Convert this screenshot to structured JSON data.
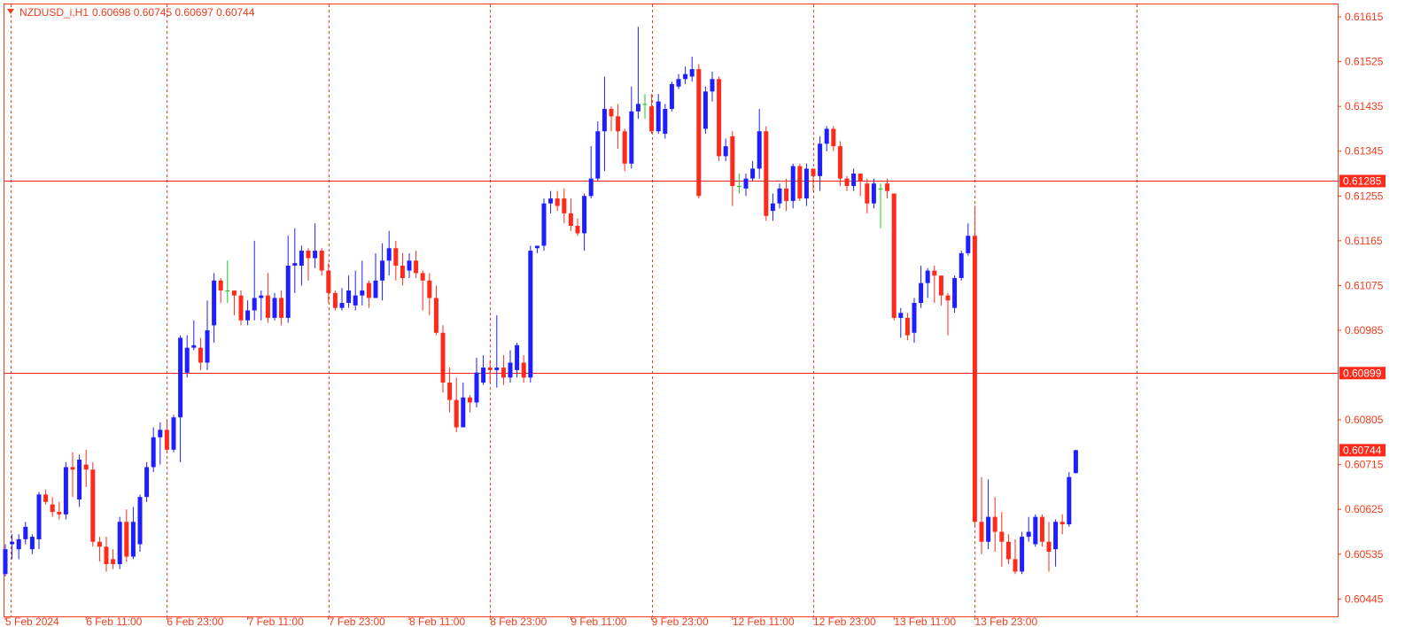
{
  "window": {
    "symbol": "NZDUSD_i,H1",
    "ohlc": "0.60698 0.60745 0.60697 0.60744"
  },
  "colors": {
    "frame": "#f23b1b",
    "bull": "#1e1eff",
    "bear": "#ff2a1a",
    "doji": "#22c322",
    "grid": "#f23b1b",
    "level_line": "#ff1a1a",
    "tag_bg": "#ff2a1a"
  },
  "chart_data": {
    "type": "candlestick",
    "title": "NZDUSD_i,H1",
    "ylim": [
      0.6041,
      0.6164
    ],
    "y_ticks": [
      "0.61615",
      "0.61525",
      "0.61435",
      "0.61345",
      "0.61255",
      "0.61165",
      "0.61075",
      "0.60985",
      "0.60805",
      "0.60715",
      "0.60625",
      "0.60535",
      "0.60445"
    ],
    "x_ticks": [
      "5 Feb 2024",
      "6 Feb 11:00",
      "6 Feb 23:00",
      "7 Feb 11:00",
      "7 Feb 23:00",
      "8 Feb 11:00",
      "8 Feb 23:00",
      "9 Feb 11:00",
      "9 Feb 23:00",
      "12 Feb 11:00",
      "12 Feb 23:00",
      "13 Feb 11:00",
      "13 Feb 23:00"
    ],
    "day_separators": [
      "6 Feb 2024",
      "7 Feb 2024",
      "8 Feb 2024",
      "9 Feb 2024",
      "12 Feb 2024",
      "13 Feb 2024",
      "14 Feb 2024"
    ],
    "horizontal_levels": [
      "0.61285",
      "0.60899"
    ],
    "current_price": "0.60744",
    "grid": false,
    "candles": [
      [
        0.60495,
        0.60545,
        0.6049,
        0.60555
      ],
      [
        0.60555,
        0.6056,
        0.60525,
        0.60575
      ],
      [
        0.60545,
        0.60565,
        0.60525,
        0.60575
      ],
      [
        0.60565,
        0.6059,
        0.60555,
        0.606
      ],
      [
        0.60545,
        0.6057,
        0.60535,
        0.60575
      ],
      [
        0.60565,
        0.60655,
        0.60545,
        0.6066
      ],
      [
        0.60655,
        0.6064,
        0.60635,
        0.60665
      ],
      [
        0.60635,
        0.6062,
        0.6061,
        0.6065
      ],
      [
        0.6062,
        0.60615,
        0.60605,
        0.6064
      ],
      [
        0.60615,
        0.6071,
        0.60605,
        0.6072
      ],
      [
        0.6071,
        0.60705,
        0.6065,
        0.6074
      ],
      [
        0.60645,
        0.60725,
        0.6063,
        0.60735
      ],
      [
        0.60715,
        0.60705,
        0.6067,
        0.60745
      ],
      [
        0.60705,
        0.6056,
        0.6055,
        0.6072
      ],
      [
        0.6056,
        0.6055,
        0.6052,
        0.6057
      ],
      [
        0.6055,
        0.60515,
        0.605,
        0.6057
      ],
      [
        0.60525,
        0.60515,
        0.60505,
        0.60545
      ],
      [
        0.60515,
        0.606,
        0.60505,
        0.6061
      ],
      [
        0.606,
        0.6053,
        0.6052,
        0.60625
      ],
      [
        0.6053,
        0.606,
        0.60525,
        0.6063
      ],
      [
        0.60555,
        0.6065,
        0.6054,
        0.60655
      ],
      [
        0.6065,
        0.6071,
        0.6064,
        0.6072
      ],
      [
        0.6071,
        0.6077,
        0.607,
        0.6079
      ],
      [
        0.6077,
        0.60785,
        0.60715,
        0.608
      ],
      [
        0.60785,
        0.60745,
        0.6074,
        0.60805
      ],
      [
        0.60745,
        0.6081,
        0.6074,
        0.60815
      ],
      [
        0.6081,
        0.6097,
        0.6072,
        0.60975
      ],
      [
        0.609,
        0.6095,
        0.6089,
        0.60975
      ],
      [
        0.6095,
        0.60955,
        0.60945,
        0.61005
      ],
      [
        0.6095,
        0.6092,
        0.60905,
        0.6097
      ],
      [
        0.6092,
        0.60985,
        0.60905,
        0.61045
      ],
      [
        0.60995,
        0.61085,
        0.6096,
        0.611
      ],
      [
        0.61085,
        0.61065,
        0.6104,
        0.6109
      ],
      [
        0.61065,
        0.61065,
        0.6104,
        0.61125
      ],
      [
        0.61065,
        0.61055,
        0.61015,
        0.6106
      ],
      [
        0.61055,
        0.61005,
        0.60995,
        0.61065
      ],
      [
        0.61005,
        0.61025,
        0.60995,
        0.61045
      ],
      [
        0.61025,
        0.6105,
        0.61005,
        0.61165
      ],
      [
        0.6105,
        0.61055,
        0.61005,
        0.61065
      ],
      [
        0.61055,
        0.6101,
        0.61,
        0.611
      ],
      [
        0.6101,
        0.6105,
        0.61005,
        0.6106
      ],
      [
        0.6105,
        0.6101,
        0.60995,
        0.61065
      ],
      [
        0.6101,
        0.61115,
        0.61,
        0.61175
      ],
      [
        0.61115,
        0.6112,
        0.6106,
        0.6119
      ],
      [
        0.61115,
        0.61145,
        0.61075,
        0.61155
      ],
      [
        0.61145,
        0.6113,
        0.61085,
        0.6115
      ],
      [
        0.6113,
        0.61145,
        0.6111,
        0.612
      ],
      [
        0.61145,
        0.61105,
        0.61095,
        0.6115
      ],
      [
        0.61105,
        0.6106,
        0.6104,
        0.6112
      ],
      [
        0.6106,
        0.6103,
        0.61025,
        0.61065
      ],
      [
        0.6103,
        0.6104,
        0.61025,
        0.6107
      ],
      [
        0.6104,
        0.61065,
        0.6103,
        0.61095
      ],
      [
        0.61035,
        0.61055,
        0.61025,
        0.61105
      ],
      [
        0.61055,
        0.61065,
        0.61035,
        0.61125
      ],
      [
        0.6108,
        0.6105,
        0.6103,
        0.61085
      ],
      [
        0.6105,
        0.61085,
        0.6105,
        0.6114
      ],
      [
        0.61085,
        0.61125,
        0.61045,
        0.6116
      ],
      [
        0.61125,
        0.6115,
        0.61095,
        0.61185
      ],
      [
        0.6115,
        0.61115,
        0.61085,
        0.61165
      ],
      [
        0.61115,
        0.6109,
        0.61075,
        0.6114
      ],
      [
        0.61105,
        0.61125,
        0.6109,
        0.6114
      ],
      [
        0.61125,
        0.611,
        0.6109,
        0.61145
      ],
      [
        0.611,
        0.61085,
        0.61025,
        0.61105
      ],
      [
        0.61085,
        0.6105,
        0.61015,
        0.611
      ],
      [
        0.6105,
        0.6098,
        0.60975,
        0.61075
      ],
      [
        0.6098,
        0.6088,
        0.6086,
        0.60995
      ],
      [
        0.6088,
        0.60845,
        0.6082,
        0.6091
      ],
      [
        0.60845,
        0.6079,
        0.6078,
        0.6089
      ],
      [
        0.6079,
        0.6085,
        0.6079,
        0.6088
      ],
      [
        0.6085,
        0.6084,
        0.6082,
        0.60855
      ],
      [
        0.6084,
        0.609,
        0.6083,
        0.6093
      ],
      [
        0.6088,
        0.6091,
        0.60875,
        0.60935
      ],
      [
        0.6091,
        0.60905,
        0.6088,
        0.60925
      ],
      [
        0.60905,
        0.6091,
        0.6087,
        0.61015
      ],
      [
        0.6091,
        0.6089,
        0.60875,
        0.60935
      ],
      [
        0.6089,
        0.6092,
        0.6088,
        0.60945
      ],
      [
        0.60905,
        0.60955,
        0.6089,
        0.6096
      ],
      [
        0.6092,
        0.6089,
        0.6088,
        0.60935
      ],
      [
        0.6089,
        0.61145,
        0.6088,
        0.61155
      ],
      [
        0.6115,
        0.61155,
        0.6114,
        0.6115
      ],
      [
        0.61155,
        0.6124,
        0.61145,
        0.6125
      ],
      [
        0.6124,
        0.6125,
        0.6122,
        0.61265
      ],
      [
        0.6125,
        0.61235,
        0.61225,
        0.61265
      ],
      [
        0.6125,
        0.6122,
        0.612,
        0.6127
      ],
      [
        0.6122,
        0.61195,
        0.61185,
        0.6125
      ],
      [
        0.61195,
        0.6118,
        0.61175,
        0.6121
      ],
      [
        0.6118,
        0.61255,
        0.61145,
        0.6126
      ],
      [
        0.61255,
        0.6129,
        0.6125,
        0.61355
      ],
      [
        0.6129,
        0.61385,
        0.61285,
        0.61405
      ],
      [
        0.61385,
        0.6143,
        0.61305,
        0.61495
      ],
      [
        0.6143,
        0.61415,
        0.61385,
        0.61435
      ],
      [
        0.61415,
        0.61385,
        0.6135,
        0.6144
      ],
      [
        0.61385,
        0.6132,
        0.61305,
        0.6139
      ],
      [
        0.6132,
        0.61425,
        0.6131,
        0.61475
      ],
      [
        0.61425,
        0.6144,
        0.6141,
        0.61595
      ],
      [
        0.6144,
        0.6144,
        0.6141,
        0.6146
      ],
      [
        0.61435,
        0.61385,
        0.6138,
        0.6146
      ],
      [
        0.61385,
        0.61445,
        0.6138,
        0.6146
      ],
      [
        0.6138,
        0.6143,
        0.6137,
        0.6144
      ],
      [
        0.6143,
        0.6148,
        0.61425,
        0.61485
      ],
      [
        0.61475,
        0.6149,
        0.6147,
        0.615
      ],
      [
        0.6149,
        0.615,
        0.6148,
        0.61515
      ],
      [
        0.61495,
        0.6151,
        0.61485,
        0.61535
      ],
      [
        0.6151,
        0.61255,
        0.6125,
        0.6152
      ],
      [
        0.6139,
        0.61465,
        0.6138,
        0.61475
      ],
      [
        0.61465,
        0.6149,
        0.61445,
        0.61505
      ],
      [
        0.6149,
        0.61335,
        0.61325,
        0.61495
      ],
      [
        0.61335,
        0.61355,
        0.61325,
        0.6137
      ],
      [
        0.61375,
        0.61275,
        0.61235,
        0.61385
      ],
      [
        0.61275,
        0.61275,
        0.6126,
        0.613
      ],
      [
        0.6127,
        0.6129,
        0.61255,
        0.613
      ],
      [
        0.6129,
        0.6131,
        0.61285,
        0.61325
      ],
      [
        0.6131,
        0.61385,
        0.6129,
        0.6143
      ],
      [
        0.61385,
        0.61215,
        0.61205,
        0.61395
      ],
      [
        0.61225,
        0.6124,
        0.61205,
        0.6126
      ],
      [
        0.6124,
        0.6127,
        0.6123,
        0.6128
      ],
      [
        0.6127,
        0.61245,
        0.61225,
        0.6129
      ],
      [
        0.61245,
        0.61315,
        0.6123,
        0.6132
      ],
      [
        0.61315,
        0.6125,
        0.61245,
        0.6132
      ],
      [
        0.6125,
        0.6131,
        0.61235,
        0.6132
      ],
      [
        0.6131,
        0.61295,
        0.61265,
        0.613
      ],
      [
        0.61295,
        0.6136,
        0.61265,
        0.61375
      ],
      [
        0.6136,
        0.6139,
        0.61345,
        0.61395
      ],
      [
        0.6139,
        0.61355,
        0.61345,
        0.61395
      ],
      [
        0.61355,
        0.6129,
        0.61275,
        0.61365
      ],
      [
        0.6129,
        0.61275,
        0.61265,
        0.61295
      ],
      [
        0.61275,
        0.613,
        0.61265,
        0.6131
      ],
      [
        0.613,
        0.61285,
        0.61255,
        0.613
      ],
      [
        0.6128,
        0.6124,
        0.6122,
        0.6129
      ],
      [
        0.6124,
        0.6128,
        0.6123,
        0.6129
      ],
      [
        0.6127,
        0.6127,
        0.6119,
        0.6128
      ],
      [
        0.6128,
        0.61265,
        0.6125,
        0.6129
      ],
      [
        0.6126,
        0.6101,
        0.61005,
        0.6126
      ],
      [
        0.6101,
        0.6102,
        0.6097,
        0.6103
      ],
      [
        0.6101,
        0.60975,
        0.60965,
        0.6102
      ],
      [
        0.6098,
        0.6104,
        0.6096,
        0.6105
      ],
      [
        0.6104,
        0.6108,
        0.6103,
        0.61115
      ],
      [
        0.6108,
        0.61105,
        0.6105,
        0.6111
      ],
      [
        0.61105,
        0.61095,
        0.6104,
        0.61115
      ],
      [
        0.61095,
        0.61055,
        0.61035,
        0.6107
      ],
      [
        0.61055,
        0.61045,
        0.60975,
        0.6106
      ],
      [
        0.6103,
        0.6109,
        0.6102,
        0.61095
      ],
      [
        0.6109,
        0.6114,
        0.61085,
        0.61145
      ],
      [
        0.6114,
        0.61175,
        0.61135,
        0.612
      ],
      [
        0.61175,
        0.606,
        0.6059,
        0.61235
      ],
      [
        0.606,
        0.6056,
        0.60535,
        0.6069
      ],
      [
        0.6056,
        0.6061,
        0.60545,
        0.60685
      ],
      [
        0.6061,
        0.6058,
        0.6054,
        0.6065
      ],
      [
        0.6058,
        0.6056,
        0.6051,
        0.6062
      ],
      [
        0.6056,
        0.60525,
        0.60515,
        0.60575
      ],
      [
        0.60525,
        0.605,
        0.60495,
        0.60565
      ],
      [
        0.605,
        0.6057,
        0.60495,
        0.6058
      ],
      [
        0.6057,
        0.6058,
        0.6056,
        0.6061
      ],
      [
        0.60555,
        0.6061,
        0.6055,
        0.60615
      ],
      [
        0.6061,
        0.6056,
        0.6055,
        0.60615
      ],
      [
        0.6056,
        0.6054,
        0.605,
        0.606
      ],
      [
        0.60545,
        0.606,
        0.6051,
        0.60605
      ],
      [
        0.606,
        0.60595,
        0.60575,
        0.60615
      ],
      [
        0.60595,
        0.6069,
        0.6059,
        0.607
      ],
      [
        0.60698,
        0.60744,
        0.60697,
        0.60745
      ]
    ]
  }
}
